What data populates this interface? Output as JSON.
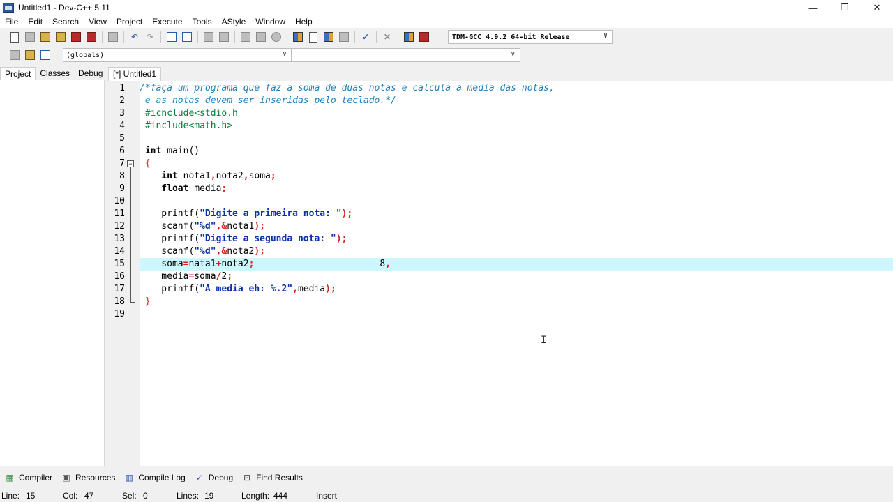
{
  "window": {
    "title": "Untitled1 - Dev-C++ 5.11",
    "controls": {
      "minimize": "—",
      "restore": "❐",
      "close": "✕"
    }
  },
  "menu": [
    "File",
    "Edit",
    "Search",
    "View",
    "Project",
    "Execute",
    "Tools",
    "AStyle",
    "Window",
    "Help"
  ],
  "toolbar": {
    "compiler_selected": "TDM-GCC 4.9.2 64-bit Release",
    "scope_selected": "(globals)",
    "function_selected": ""
  },
  "left_panel": {
    "tabs": [
      "Project",
      "Classes",
      "Debug"
    ],
    "active_tab": "Project"
  },
  "editor": {
    "tab_label": "[*] Untitled1",
    "current_line": 15,
    "lines": [
      [
        {
          "t": "/*faça um programa que faz a soma de duas notas e calcula a media das notas,",
          "c": "comment"
        }
      ],
      [
        {
          "t": " e as notas devem ser inseridas pelo teclado.*/",
          "c": "comment"
        }
      ],
      [
        {
          "t": " #icnclude<stdio.h",
          "c": "pre"
        }
      ],
      [
        {
          "t": " #include<math.h>",
          "c": "pre"
        }
      ],
      [],
      [
        {
          "t": " int",
          "c": "kw"
        },
        {
          "t": " main()",
          "c": "id"
        }
      ],
      [
        {
          "t": " {",
          "c": "brace"
        }
      ],
      [
        {
          "t": "    int",
          "c": "kw"
        },
        {
          "t": " nota1",
          "c": "id"
        },
        {
          "t": ",",
          "c": "sym"
        },
        {
          "t": "nota2",
          "c": "id"
        },
        {
          "t": ",",
          "c": "sym"
        },
        {
          "t": "soma",
          "c": "id"
        },
        {
          "t": ";",
          "c": "sym"
        }
      ],
      [
        {
          "t": "    float",
          "c": "kw"
        },
        {
          "t": " media",
          "c": "id"
        },
        {
          "t": ";",
          "c": "sym"
        }
      ],
      [],
      [
        {
          "t": "    printf(",
          "c": "id"
        },
        {
          "t": "\"Digite a primeira nota: \"",
          "c": "str"
        },
        {
          "t": ");",
          "c": "sym"
        }
      ],
      [
        {
          "t": "    scanf(",
          "c": "id"
        },
        {
          "t": "\"%d\"",
          "c": "str"
        },
        {
          "t": ",&",
          "c": "sym"
        },
        {
          "t": "nota1",
          "c": "id"
        },
        {
          "t": ");",
          "c": "sym"
        }
      ],
      [
        {
          "t": "    printf(",
          "c": "id"
        },
        {
          "t": "\"Digite a segunda nota: \"",
          "c": "str"
        },
        {
          "t": ");",
          "c": "sym"
        }
      ],
      [
        {
          "t": "    scanf(",
          "c": "id"
        },
        {
          "t": "\"%d\"",
          "c": "str"
        },
        {
          "t": ",&",
          "c": "sym"
        },
        {
          "t": "nota2",
          "c": "id"
        },
        {
          "t": ");",
          "c": "sym"
        }
      ],
      [
        {
          "t": "    soma",
          "c": "id"
        },
        {
          "t": "=",
          "c": "sym"
        },
        {
          "t": "nata1",
          "c": "id"
        },
        {
          "t": "+",
          "c": "sym"
        },
        {
          "t": "nota2",
          "c": "id"
        },
        {
          "t": ";",
          "c": "sym"
        },
        {
          "t": "                       8",
          "c": "id"
        },
        {
          "t": ",",
          "c": "sym"
        }
      ],
      [
        {
          "t": "    media",
          "c": "id"
        },
        {
          "t": "=",
          "c": "sym"
        },
        {
          "t": "soma",
          "c": "id"
        },
        {
          "t": "/",
          "c": "sym"
        },
        {
          "t": "2",
          "c": "id"
        },
        {
          "t": ";",
          "c": "sym"
        }
      ],
      [
        {
          "t": "    printf(",
          "c": "id"
        },
        {
          "t": "\"A media eh: %.2\"",
          "c": "str"
        },
        {
          "t": ",",
          "c": "sym"
        },
        {
          "t": "media",
          "c": "id"
        },
        {
          "t": ");",
          "c": "sym"
        }
      ],
      [
        {
          "t": " }",
          "c": "brace"
        }
      ],
      []
    ]
  },
  "bottom_tabs": [
    "Compiler",
    "Resources",
    "Compile Log",
    "Debug",
    "Find Results"
  ],
  "status": {
    "line_label": "Line:",
    "line_value": "15",
    "col_label": "Col:",
    "col_value": "47",
    "sel_label": "Sel:",
    "sel_value": "0",
    "lines_label": "Lines:",
    "lines_value": "19",
    "length_label": "Length:",
    "length_value": "444",
    "mode": "Insert"
  }
}
